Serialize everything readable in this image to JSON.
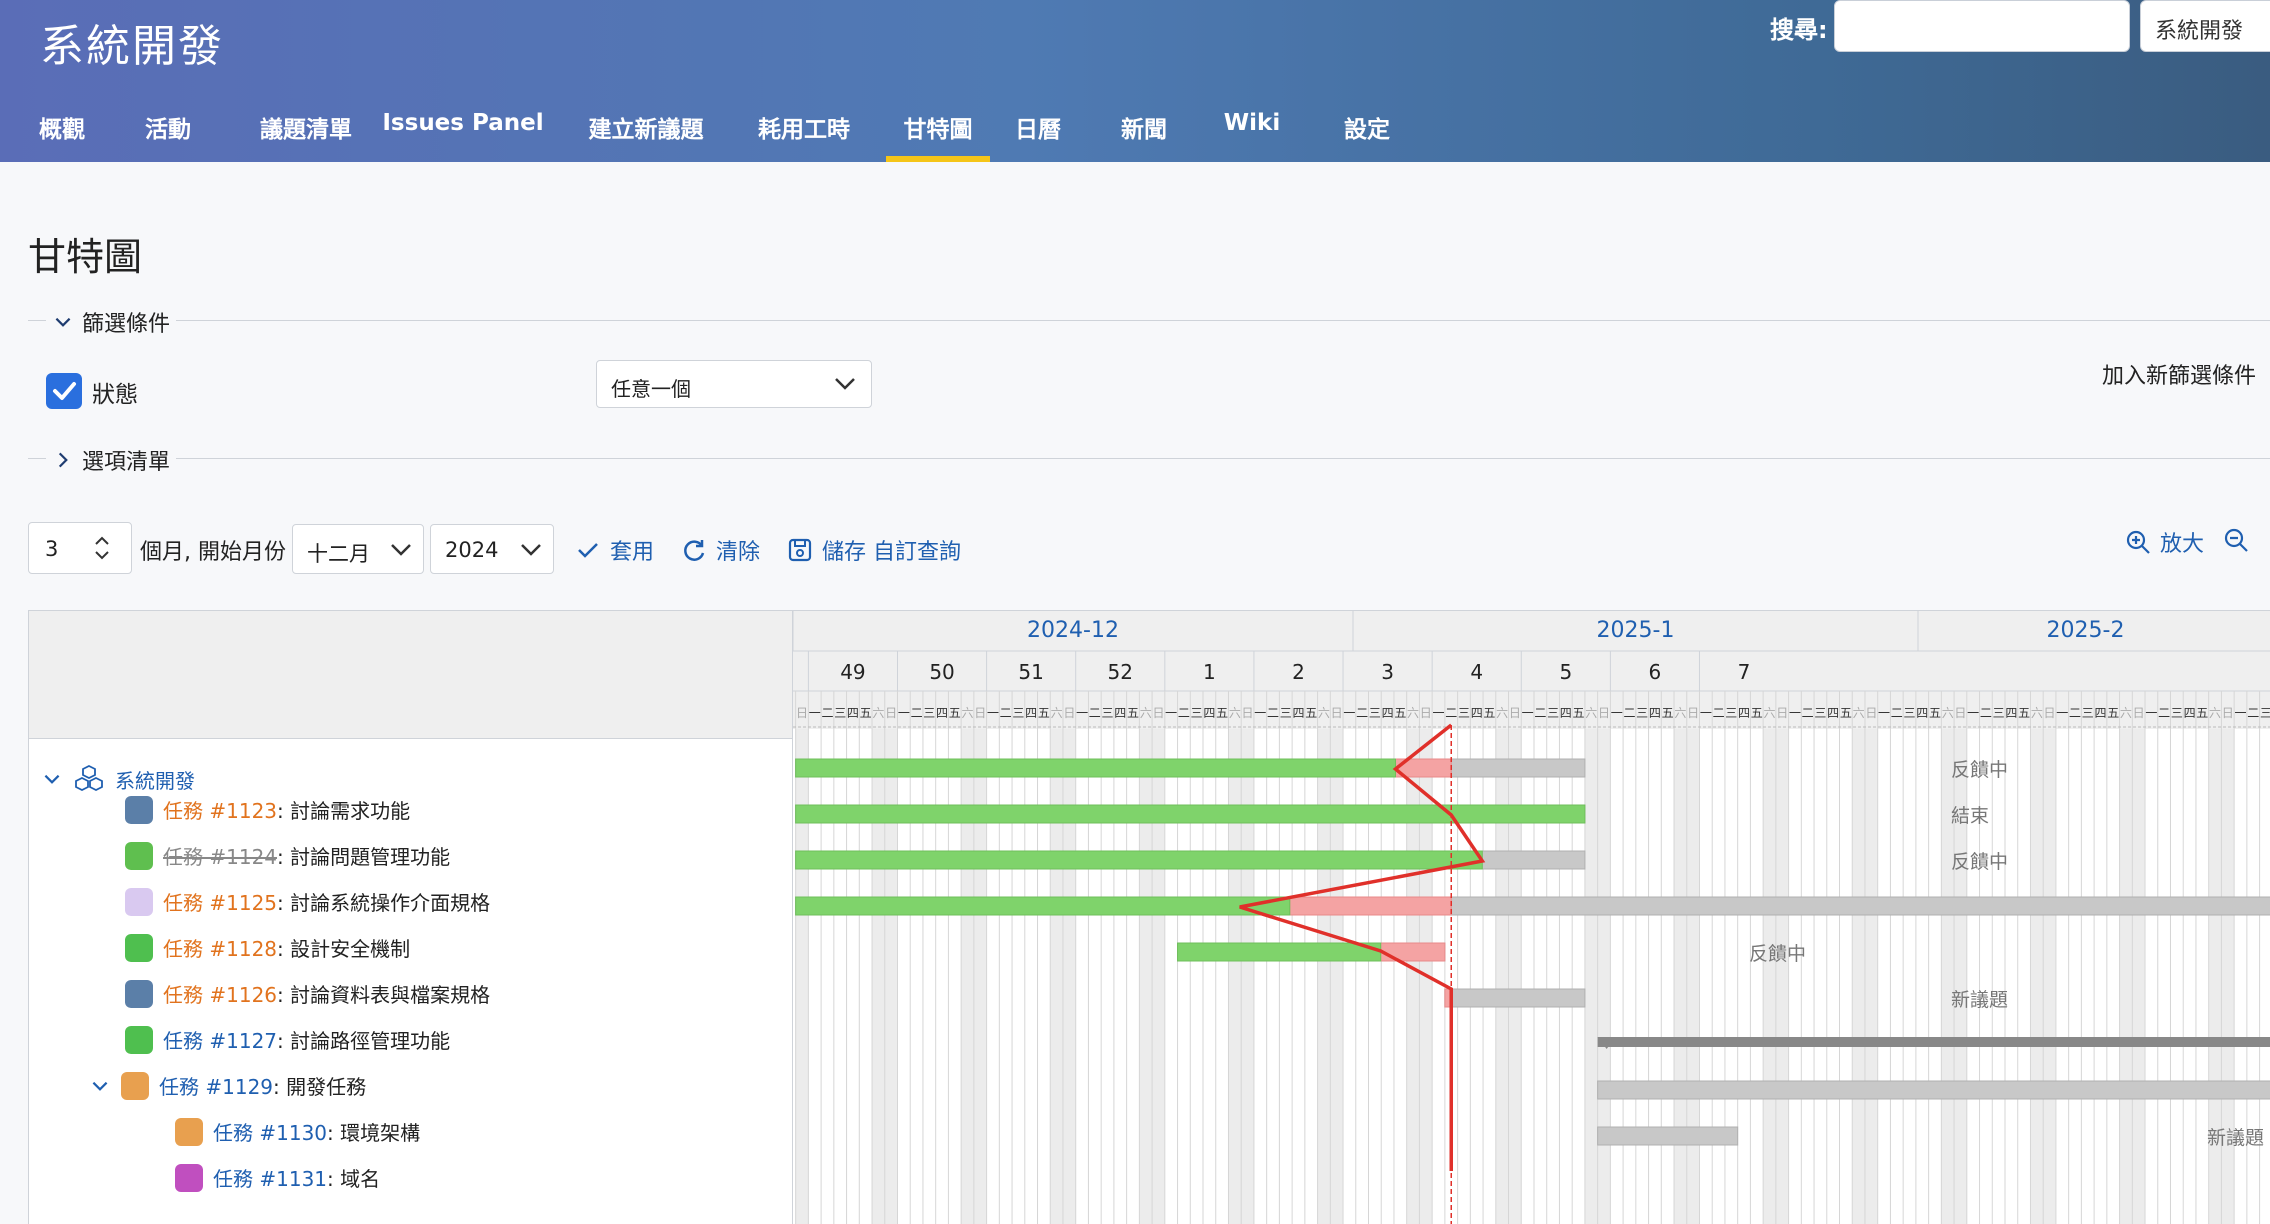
{
  "header": {
    "app_title": "系統開發",
    "search_label": "搜尋:",
    "project_select": "系統開發"
  },
  "tabs": [
    {
      "label": "概觀",
      "active": false
    },
    {
      "label": "活動",
      "active": false
    },
    {
      "label": "議題清單",
      "active": false
    },
    {
      "label": "Issues Panel",
      "active": false
    },
    {
      "label": "建立新議題",
      "active": false
    },
    {
      "label": "耗用工時",
      "active": false
    },
    {
      "label": "甘特圖",
      "active": true
    },
    {
      "label": "日曆",
      "active": false
    },
    {
      "label": "新聞",
      "active": false
    },
    {
      "label": "Wiki",
      "active": false
    },
    {
      "label": "設定",
      "active": false
    }
  ],
  "page": {
    "title": "甘特圖",
    "filters_legend": "篩選條件",
    "status_label": "狀態",
    "status_checked": true,
    "operator": "任意一個",
    "add_filter": "加入新篩選條件",
    "options_legend": "選項清單"
  },
  "controls": {
    "months": "3",
    "months_label": "個月, 開始月份",
    "month": "十二月",
    "year": "2024",
    "apply": "套用",
    "clear": "清除",
    "save": "儲存 自訂查詢",
    "zoom_in": "放大"
  },
  "gantt": {
    "months": [
      "2024-12",
      "2025-1",
      "2025-2"
    ],
    "weeks": [
      "49",
      "50",
      "51",
      "52",
      "1",
      "2",
      "3",
      "4",
      "5",
      "6",
      "7"
    ],
    "weekdays": [
      "一",
      "二",
      "三",
      "四",
      "五",
      "六",
      "日"
    ],
    "project": "系統開發",
    "issues": [
      {
        "id": "任務 #1123",
        "subject": ": 討論需求功能",
        "status": "反饋中",
        "style": "orange"
      },
      {
        "id": "任務 #1124",
        "subject": ": 討論問題管理功能",
        "status": "結束",
        "style": "closed"
      },
      {
        "id": "任務 #1125",
        "subject": ": 討論系統操作介面規格",
        "status": "反饋中",
        "style": "orange"
      },
      {
        "id": "任務 #1128",
        "subject": ": 設計安全機制",
        "status": "",
        "style": "orange"
      },
      {
        "id": "任務 #1126",
        "subject": ": 討論資料表與檔案規格",
        "status": "反饋中",
        "style": "orange"
      },
      {
        "id": "任務 #1127",
        "subject": ": 討論路徑管理功能",
        "status": "新議題",
        "style": "blue"
      },
      {
        "id": "任務 #1129",
        "subject": ": 開發任務",
        "status": "",
        "style": "blue"
      },
      {
        "id": "任務 #1130",
        "subject": ": 環境架構",
        "status": "",
        "style": "blue"
      },
      {
        "id": "任務 #1131",
        "subject": ": 域名",
        "status": "新議題",
        "style": "blue"
      }
    ]
  },
  "colors": {
    "done": "#7fd36b",
    "late": "#f4a3a3",
    "todo": "#c8c8c8",
    "today_line": "#e0302a",
    "link": "#1f5fb0",
    "issue_orange": "#e1731e"
  }
}
